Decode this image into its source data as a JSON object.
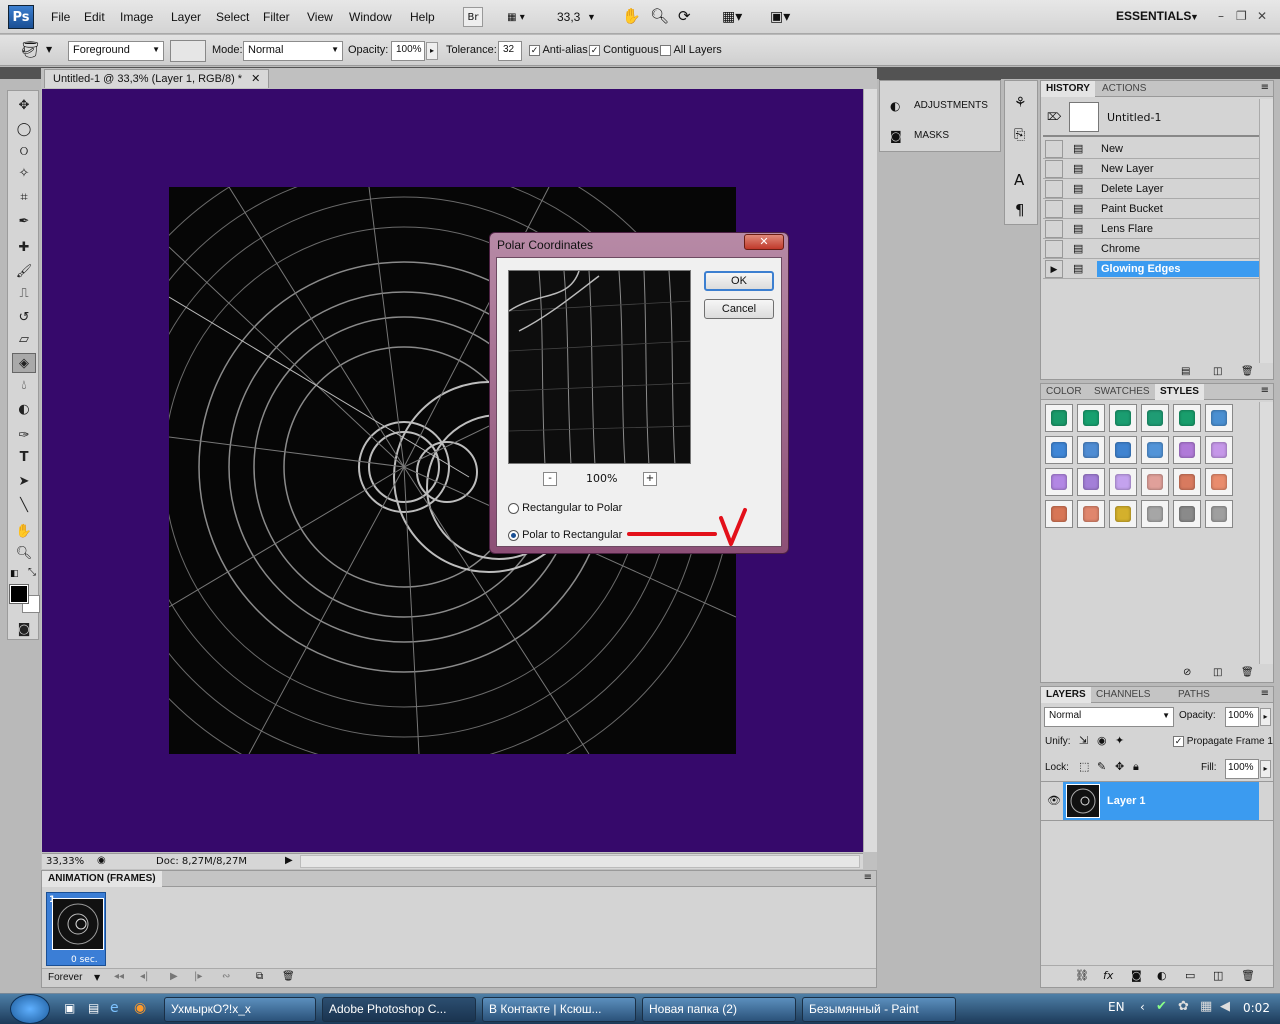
{
  "app": {
    "logo": "Ps"
  },
  "menu": [
    "File",
    "Edit",
    "Image",
    "Layer",
    "Select",
    "Filter",
    "View",
    "Window",
    "Help"
  ],
  "menubar": {
    "br": "Br",
    "zoom": "33,3",
    "workspace": "ESSENTIALS"
  },
  "options": {
    "fill_source": "Foreground",
    "mode_label": "Mode:",
    "mode_value": "Normal",
    "opacity_label": "Opacity:",
    "opacity_value": "100%",
    "tolerance_label": "Tolerance:",
    "tolerance_value": "32",
    "antialias": "Anti-alias",
    "contiguous": "Contiguous",
    "all_layers": "All Layers"
  },
  "document": {
    "tab_title": "Untitled-1 @ 33,3% (Layer 1, RGB/8) *",
    "canvas_color": "#36096b",
    "status_zoom": "33,33%",
    "status_doc": "Doc: 8,27M/8,27M"
  },
  "dialog": {
    "title": "Polar Coordinates",
    "ok": "OK",
    "cancel": "Cancel",
    "preview_zoom": "100%",
    "zoom_out": "-",
    "zoom_in": "+",
    "option1": "Rectangular to Polar",
    "option2": "Polar to Rectangular",
    "selected": "Polar to Rectangular"
  },
  "adjustments": {
    "adjustments": "ADJUSTMENTS",
    "masks": "MASKS"
  },
  "history": {
    "tabs": [
      "HISTORY",
      "ACTIONS"
    ],
    "snapshot": "Untitled-1",
    "items": [
      "New",
      "New Layer",
      "Delete Layer",
      "Paint Bucket",
      "Lens Flare",
      "Chrome",
      "Glowing Edges"
    ],
    "selected": "Glowing Edges"
  },
  "styles": {
    "tabs": [
      "COLOR",
      "SWATCHES",
      "STYLES"
    ],
    "colors": [
      "#1a9a6a",
      "#17a06f",
      "#1a9d70",
      "#1f9c74",
      "#199e6c",
      "#4a8fd1",
      "#3f86d6",
      "#4e8cd3",
      "#3f83d0",
      "#5294d8",
      "#b07ad8",
      "#c597e8",
      "#b287e4",
      "#a37fd8",
      "#c4a2ee",
      "#e0a09a",
      "#d87a5f",
      "#e98c6d",
      "#d77656",
      "#e0866d",
      "#d4b02c",
      "#a6a6a6",
      "#8a8a8a",
      "#9f9f9f"
    ]
  },
  "layers": {
    "tabs": [
      "LAYERS",
      "CHANNELS",
      "PATHS"
    ],
    "blend": "Normal",
    "opacity_label": "Opacity:",
    "opacity": "100%",
    "unify_label": "Unify:",
    "propagate": "Propagate Frame 1",
    "lock_label": "Lock:",
    "fill_label": "Fill:",
    "fill": "100%",
    "layer_name": "Layer 1"
  },
  "animation": {
    "title": "ANIMATION (FRAMES)",
    "frame_number": "1",
    "frame_delay": "0 sec.",
    "loop": "Forever"
  },
  "taskbar": {
    "items": [
      "УхмыркО?!x_x",
      "Adobe Photoshop C...",
      "В Контакте | Ксюш...",
      "Новая папка (2)",
      "Безымянный - Paint"
    ],
    "active": "Adobe Photoshop C...",
    "lang": "EN",
    "clock": "0:02"
  }
}
